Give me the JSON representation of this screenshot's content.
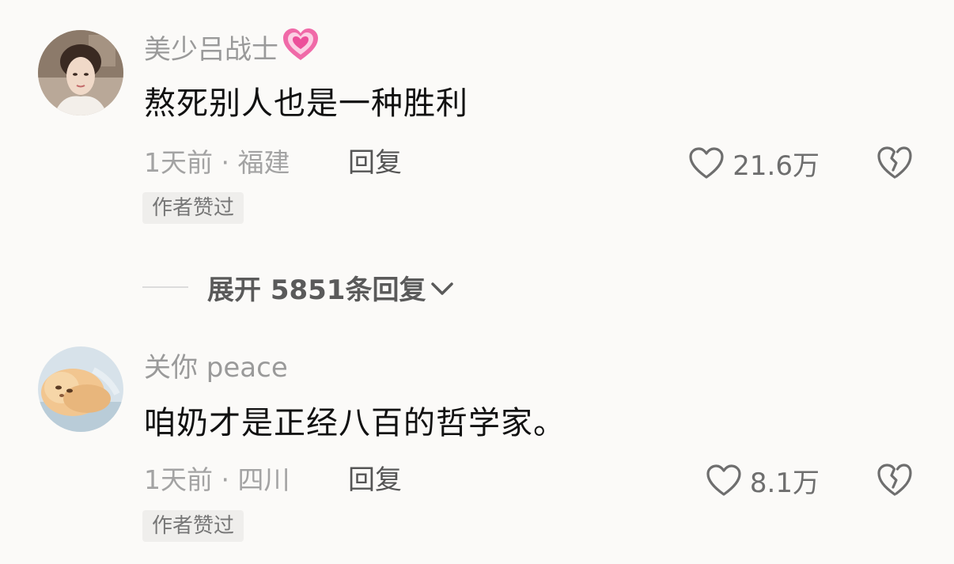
{
  "comments": [
    {
      "username": "美少吕战士",
      "username_emoji": "pink-heart-icon",
      "text": "熬死别人也是一种胜利",
      "meta": "1天前 · 福建",
      "reply_label": "回复",
      "likes": "21.6万",
      "badge": "作者赞过"
    },
    {
      "username": "关你 peace",
      "text": "咱奶才是正经八百的哲学家。",
      "meta": "1天前 · 四川",
      "reply_label": "回复",
      "likes": "8.1万",
      "badge": "作者赞过"
    }
  ],
  "expand_replies": {
    "label": "展开 5851条回复"
  },
  "colors": {
    "background": "#fbfaf8",
    "username": "#9a9a9a",
    "meta": "#a3a3a3",
    "heart_emoji": "#ec4f9a"
  }
}
